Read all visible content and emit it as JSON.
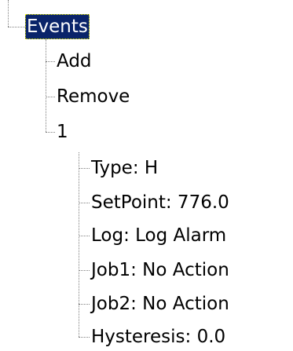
{
  "tree": {
    "root": {
      "label": "Events",
      "selected": true
    },
    "children": [
      {
        "label": "Add"
      },
      {
        "label": "Remove"
      },
      {
        "label": "1"
      }
    ],
    "event_1_properties": [
      {
        "label": "Type: H"
      },
      {
        "label": "SetPoint: 776.0"
      },
      {
        "label": "Log: Log Alarm"
      },
      {
        "label": "Job1: No Action"
      },
      {
        "label": "Job2: No Action"
      },
      {
        "label": "Hysteresis: 0.0"
      }
    ]
  },
  "colors": {
    "selection_background": "#0a246a",
    "selection_text": "#ffffff",
    "connector": "#808080"
  }
}
